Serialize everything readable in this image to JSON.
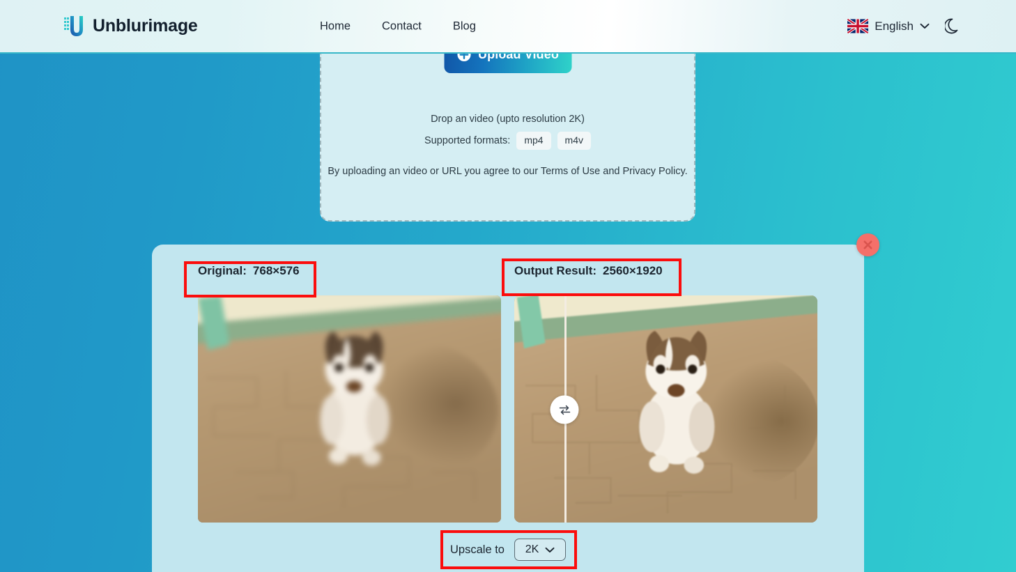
{
  "header": {
    "logo_text": "Unblurimage",
    "logo_icon": "u-logo-icon",
    "nav": [
      {
        "label": "Home"
      },
      {
        "label": "Contact"
      },
      {
        "label": "Blog"
      }
    ],
    "language": {
      "flag_icon": "uk-flag-icon",
      "label": "English",
      "chevron_icon": "chevron-down-icon"
    },
    "theme_toggle_icon": "moon-icon"
  },
  "upload": {
    "button_label": "Upload Video",
    "button_icon": "plus-circle-icon",
    "drop_hint": "Drop an video (upto resolution 2K)",
    "formats_label": "Supported formats:",
    "formats": [
      "mp4",
      "m4v"
    ],
    "terms_text": "By uploading an video or URL you agree to our Terms of Use and Privacy Policy."
  },
  "result": {
    "close_icon": "close-x-icon",
    "original": {
      "label": "Original:",
      "value": "768×576"
    },
    "output": {
      "label": "Output Result:",
      "value": "2560×1920"
    },
    "compare_handle_icon": "swap-arrows-icon",
    "upscale": {
      "label": "Upscale to",
      "value": "2K",
      "chevron_icon": "chevron-down-icon"
    }
  },
  "colors": {
    "background_start": "#1f93c6",
    "background_end": "#31cdd0",
    "accent_gradient_start": "#1157a8",
    "accent_gradient_end": "#2fd2c9",
    "panel_background": "#c2e6ef",
    "upload_panel_background": "#d5eef3",
    "annotation_red": "#fb0d0d",
    "close_button": "#f4706a"
  }
}
